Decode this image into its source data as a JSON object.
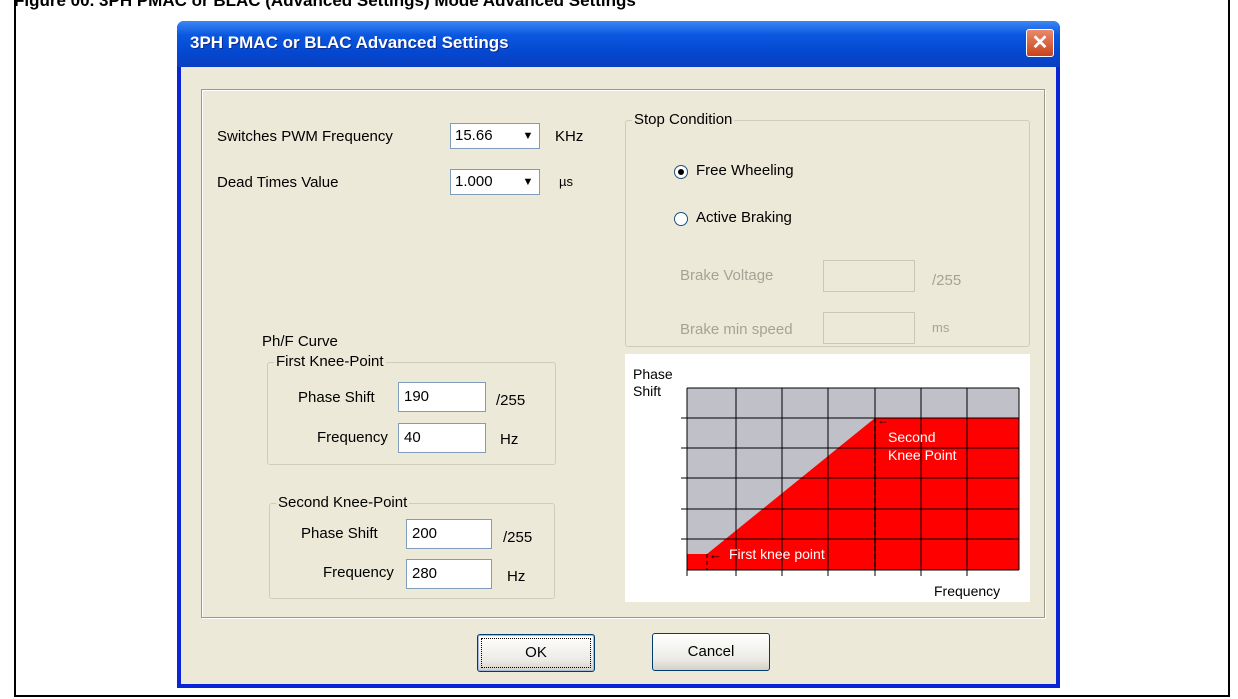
{
  "document": {
    "caption": "Figure 00. 3PH PMAC or BLAC (Advanced Settings) Mode Advanced Settings"
  },
  "dialog": {
    "title": "3PH PMAC or BLAC Advanced Settings",
    "close_glyph": "✕",
    "pwm": {
      "label": "Switches PWM Frequency",
      "value": "15.66",
      "unit": "KHz"
    },
    "dead_time": {
      "label": "Dead Times Value",
      "value": "1.000",
      "unit": "µs"
    },
    "stop_condition": {
      "title": "Stop Condition",
      "options": [
        {
          "label": "Free Wheeling",
          "selected": true
        },
        {
          "label": "Active Braking",
          "selected": false
        }
      ],
      "brake_voltage": {
        "label": "Brake Voltage",
        "value": "",
        "unit": "/255"
      },
      "brake_min_speed": {
        "label": "Brake min speed",
        "value": "",
        "unit": "ms"
      }
    },
    "curve": {
      "title": "Ph/F Curve",
      "first": {
        "title": "First Knee-Point",
        "phase_label": "Phase Shift",
        "phase_value": "190",
        "phase_unit": "/255",
        "freq_label": "Frequency",
        "freq_value": "40",
        "freq_unit": "Hz"
      },
      "second": {
        "title": "Second Knee-Point",
        "phase_label": "Phase Shift",
        "phase_value": "200",
        "phase_unit": "/255",
        "freq_label": "Frequency",
        "freq_value": "280",
        "freq_unit": "Hz"
      }
    },
    "graph": {
      "y_label_1": "Phase",
      "y_label_2": "Shift",
      "x_label": "Frequency",
      "second_knee_1": "Second",
      "second_knee_2": "Knee Point",
      "first_knee": "First knee point",
      "fill_color": "#ff0000",
      "grid_color": "#c0c0c8"
    },
    "buttons": {
      "ok": "OK",
      "cancel": "Cancel"
    }
  }
}
